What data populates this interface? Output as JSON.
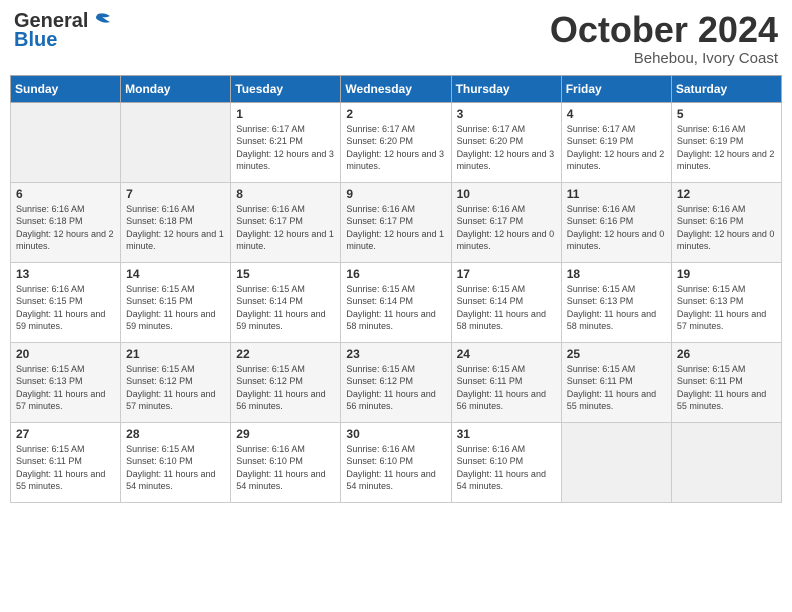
{
  "header": {
    "logo_line1": "General",
    "logo_line2": "Blue",
    "month": "October 2024",
    "location": "Behebou, Ivory Coast"
  },
  "weekdays": [
    "Sunday",
    "Monday",
    "Tuesday",
    "Wednesday",
    "Thursday",
    "Friday",
    "Saturday"
  ],
  "weeks": [
    [
      {
        "day": "",
        "empty": true
      },
      {
        "day": "",
        "empty": true
      },
      {
        "day": "1",
        "sunrise": "Sunrise: 6:17 AM",
        "sunset": "Sunset: 6:21 PM",
        "daylight": "Daylight: 12 hours and 3 minutes."
      },
      {
        "day": "2",
        "sunrise": "Sunrise: 6:17 AM",
        "sunset": "Sunset: 6:20 PM",
        "daylight": "Daylight: 12 hours and 3 minutes."
      },
      {
        "day": "3",
        "sunrise": "Sunrise: 6:17 AM",
        "sunset": "Sunset: 6:20 PM",
        "daylight": "Daylight: 12 hours and 3 minutes."
      },
      {
        "day": "4",
        "sunrise": "Sunrise: 6:17 AM",
        "sunset": "Sunset: 6:19 PM",
        "daylight": "Daylight: 12 hours and 2 minutes."
      },
      {
        "day": "5",
        "sunrise": "Sunrise: 6:16 AM",
        "sunset": "Sunset: 6:19 PM",
        "daylight": "Daylight: 12 hours and 2 minutes."
      }
    ],
    [
      {
        "day": "6",
        "sunrise": "Sunrise: 6:16 AM",
        "sunset": "Sunset: 6:18 PM",
        "daylight": "Daylight: 12 hours and 2 minutes."
      },
      {
        "day": "7",
        "sunrise": "Sunrise: 6:16 AM",
        "sunset": "Sunset: 6:18 PM",
        "daylight": "Daylight: 12 hours and 1 minute."
      },
      {
        "day": "8",
        "sunrise": "Sunrise: 6:16 AM",
        "sunset": "Sunset: 6:17 PM",
        "daylight": "Daylight: 12 hours and 1 minute."
      },
      {
        "day": "9",
        "sunrise": "Sunrise: 6:16 AM",
        "sunset": "Sunset: 6:17 PM",
        "daylight": "Daylight: 12 hours and 1 minute."
      },
      {
        "day": "10",
        "sunrise": "Sunrise: 6:16 AM",
        "sunset": "Sunset: 6:17 PM",
        "daylight": "Daylight: 12 hours and 0 minutes."
      },
      {
        "day": "11",
        "sunrise": "Sunrise: 6:16 AM",
        "sunset": "Sunset: 6:16 PM",
        "daylight": "Daylight: 12 hours and 0 minutes."
      },
      {
        "day": "12",
        "sunrise": "Sunrise: 6:16 AM",
        "sunset": "Sunset: 6:16 PM",
        "daylight": "Daylight: 12 hours and 0 minutes."
      }
    ],
    [
      {
        "day": "13",
        "sunrise": "Sunrise: 6:16 AM",
        "sunset": "Sunset: 6:15 PM",
        "daylight": "Daylight: 11 hours and 59 minutes."
      },
      {
        "day": "14",
        "sunrise": "Sunrise: 6:15 AM",
        "sunset": "Sunset: 6:15 PM",
        "daylight": "Daylight: 11 hours and 59 minutes."
      },
      {
        "day": "15",
        "sunrise": "Sunrise: 6:15 AM",
        "sunset": "Sunset: 6:14 PM",
        "daylight": "Daylight: 11 hours and 59 minutes."
      },
      {
        "day": "16",
        "sunrise": "Sunrise: 6:15 AM",
        "sunset": "Sunset: 6:14 PM",
        "daylight": "Daylight: 11 hours and 58 minutes."
      },
      {
        "day": "17",
        "sunrise": "Sunrise: 6:15 AM",
        "sunset": "Sunset: 6:14 PM",
        "daylight": "Daylight: 11 hours and 58 minutes."
      },
      {
        "day": "18",
        "sunrise": "Sunrise: 6:15 AM",
        "sunset": "Sunset: 6:13 PM",
        "daylight": "Daylight: 11 hours and 58 minutes."
      },
      {
        "day": "19",
        "sunrise": "Sunrise: 6:15 AM",
        "sunset": "Sunset: 6:13 PM",
        "daylight": "Daylight: 11 hours and 57 minutes."
      }
    ],
    [
      {
        "day": "20",
        "sunrise": "Sunrise: 6:15 AM",
        "sunset": "Sunset: 6:13 PM",
        "daylight": "Daylight: 11 hours and 57 minutes."
      },
      {
        "day": "21",
        "sunrise": "Sunrise: 6:15 AM",
        "sunset": "Sunset: 6:12 PM",
        "daylight": "Daylight: 11 hours and 57 minutes."
      },
      {
        "day": "22",
        "sunrise": "Sunrise: 6:15 AM",
        "sunset": "Sunset: 6:12 PM",
        "daylight": "Daylight: 11 hours and 56 minutes."
      },
      {
        "day": "23",
        "sunrise": "Sunrise: 6:15 AM",
        "sunset": "Sunset: 6:12 PM",
        "daylight": "Daylight: 11 hours and 56 minutes."
      },
      {
        "day": "24",
        "sunrise": "Sunrise: 6:15 AM",
        "sunset": "Sunset: 6:11 PM",
        "daylight": "Daylight: 11 hours and 56 minutes."
      },
      {
        "day": "25",
        "sunrise": "Sunrise: 6:15 AM",
        "sunset": "Sunset: 6:11 PM",
        "daylight": "Daylight: 11 hours and 55 minutes."
      },
      {
        "day": "26",
        "sunrise": "Sunrise: 6:15 AM",
        "sunset": "Sunset: 6:11 PM",
        "daylight": "Daylight: 11 hours and 55 minutes."
      }
    ],
    [
      {
        "day": "27",
        "sunrise": "Sunrise: 6:15 AM",
        "sunset": "Sunset: 6:11 PM",
        "daylight": "Daylight: 11 hours and 55 minutes."
      },
      {
        "day": "28",
        "sunrise": "Sunrise: 6:15 AM",
        "sunset": "Sunset: 6:10 PM",
        "daylight": "Daylight: 11 hours and 54 minutes."
      },
      {
        "day": "29",
        "sunrise": "Sunrise: 6:16 AM",
        "sunset": "Sunset: 6:10 PM",
        "daylight": "Daylight: 11 hours and 54 minutes."
      },
      {
        "day": "30",
        "sunrise": "Sunrise: 6:16 AM",
        "sunset": "Sunset: 6:10 PM",
        "daylight": "Daylight: 11 hours and 54 minutes."
      },
      {
        "day": "31",
        "sunrise": "Sunrise: 6:16 AM",
        "sunset": "Sunset: 6:10 PM",
        "daylight": "Daylight: 11 hours and 54 minutes."
      },
      {
        "day": "",
        "empty": true
      },
      {
        "day": "",
        "empty": true
      }
    ]
  ]
}
